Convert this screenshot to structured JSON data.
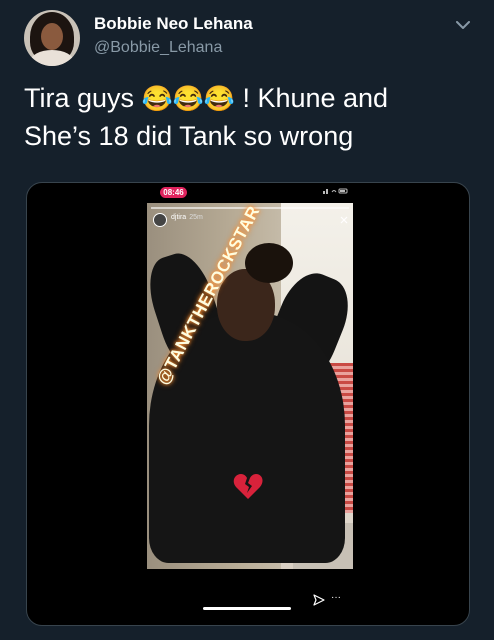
{
  "tweet": {
    "display_name": "Bobbie Neo Lehana",
    "handle": "@Bobbie_Lehana",
    "text_line1": "Tira guys",
    "emojis": "😂😂😂",
    "text_line1_end": " ! Khune and",
    "text_line2": "She’s 18 did Tank so wrong"
  },
  "icons": {
    "caret": "chevron-down-icon",
    "send": "send-icon",
    "more": "more-icon",
    "close": "close-icon",
    "heart": "broken-heart-icon"
  },
  "media": {
    "status_time": "08:46",
    "story_user": "djtira",
    "story_time": "25m",
    "mention": "@TANKTHEROCKSTAR",
    "more_glyph": "···"
  },
  "colors": {
    "background": "#15202b",
    "secondary_text": "#8899a6",
    "border": "#38444d",
    "status_pill": "#e0245e"
  }
}
